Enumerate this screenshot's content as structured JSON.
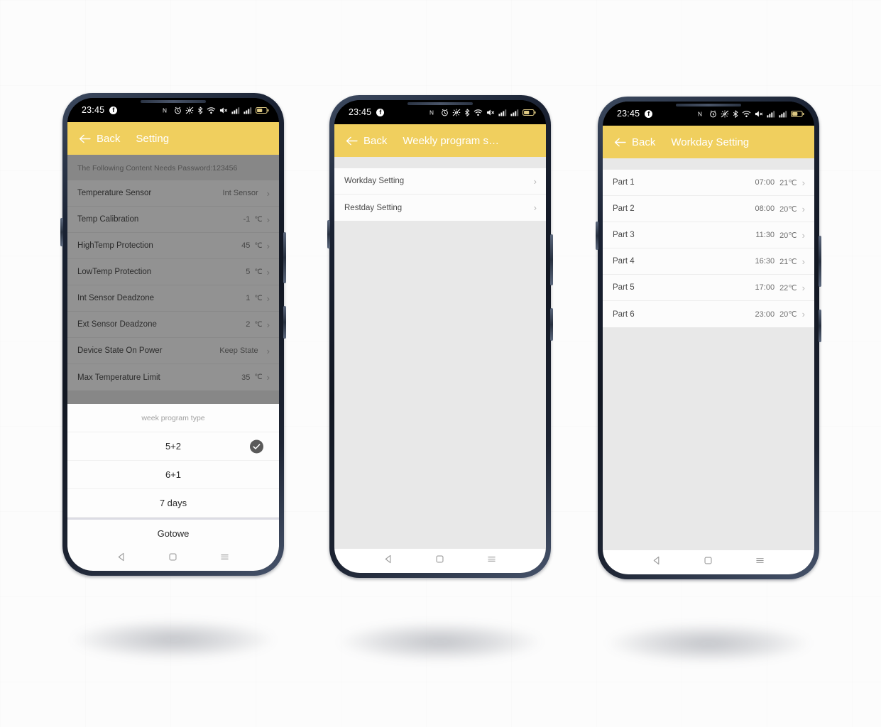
{
  "background_color": "#fcfcfc",
  "accent_color": "#f0cf5e",
  "accent_color_dimmed": "#8a7628",
  "status_bar": {
    "clock": "23:45",
    "app_badge_icon": "facebook-icon",
    "icons": [
      "nfc-icon",
      "alarm-icon",
      "location-off-icon",
      "bluetooth-icon",
      "wifi-icon",
      "mute-icon",
      "signal-bars-1-icon",
      "signal-bars-2-icon",
      "battery-icon"
    ]
  },
  "nav_bar": {
    "back_icon": "triangle-back-icon",
    "home_icon": "square-home-icon",
    "recents_icon": "menu-recents-icon"
  },
  "phone1": {
    "header": {
      "back_label": "Back",
      "title": "Setting",
      "back_icon": "arrow-left-icon"
    },
    "hint": "The Following Content Needs Password:123456",
    "settings": [
      {
        "label": "Temperature Sensor",
        "value": "Int Sensor",
        "unit": ""
      },
      {
        "label": "Temp Calibration",
        "value": "-1",
        "unit": "℃"
      },
      {
        "label": "HighTemp Protection",
        "value": "45",
        "unit": "℃"
      },
      {
        "label": "LowTemp Protection",
        "value": "5",
        "unit": "℃"
      },
      {
        "label": "Int Sensor Deadzone",
        "value": "1",
        "unit": "℃"
      },
      {
        "label": "Ext Sensor Deadzone",
        "value": "2",
        "unit": "℃"
      },
      {
        "label": "Device State On Power",
        "value": "Keep State",
        "unit": ""
      },
      {
        "label": "Max Temperature Limit",
        "value": "35",
        "unit": "℃"
      }
    ],
    "sheet": {
      "title": "week program type",
      "options": [
        {
          "label": "5+2",
          "selected": true
        },
        {
          "label": "6+1",
          "selected": false
        },
        {
          "label": "7 days",
          "selected": false
        }
      ],
      "done_label": "Gotowe",
      "check_icon": "check-icon"
    }
  },
  "phone2": {
    "header": {
      "back_label": "Back",
      "title": "Weekly program s…",
      "back_icon": "arrow-left-icon"
    },
    "items": [
      {
        "label": "Workday Setting"
      },
      {
        "label": "Restday Setting"
      }
    ]
  },
  "phone3": {
    "header": {
      "back_label": "Back",
      "title": "Workday Setting",
      "back_icon": "arrow-left-icon"
    },
    "parts": [
      {
        "label": "Part 1",
        "time": "07:00",
        "temp": "21℃"
      },
      {
        "label": "Part 2",
        "time": "08:00",
        "temp": "20℃"
      },
      {
        "label": "Part 3",
        "time": "11:30",
        "temp": "20℃"
      },
      {
        "label": "Part 4",
        "time": "16:30",
        "temp": "21℃"
      },
      {
        "label": "Part 5",
        "time": "17:00",
        "temp": "22℃"
      },
      {
        "label": "Part 6",
        "time": "23:00",
        "temp": "20℃"
      }
    ]
  }
}
